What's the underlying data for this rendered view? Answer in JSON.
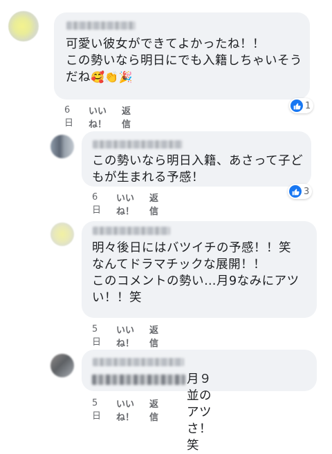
{
  "comments": [
    {
      "text": "可愛い彼女ができてよかったね！！\nこの勢いなら明日にでも入籍しちゃいそうだね",
      "emojis": "🥰👏🎉",
      "time": "6日",
      "like_label": "いいね！",
      "reply_label": "返信",
      "reaction_count": "1"
    },
    {
      "text": "この勢いなら明日入籍、あさって子どもが生まれる予感！",
      "time": "6日",
      "like_label": "いいね！",
      "reply_label": "返信",
      "reaction_count": "3"
    },
    {
      "text": "明々後日にはバツイチの予感！！笑\nなんてドラマチックな展開！！\nこのコメントの勢い…月9なみにアツい！！笑",
      "time": "5日",
      "like_label": "いいね！",
      "reply_label": "返信"
    },
    {
      "text": "月９並のアツさ！笑",
      "time": "5日",
      "like_label": "いいね！",
      "reply_label": "返信"
    }
  ],
  "colors": {
    "bubble": "#f0f2f5",
    "like_blue": "#1877f2",
    "meta_text": "#65676b"
  },
  "icons": {
    "reaction": "like-thumb-icon"
  }
}
